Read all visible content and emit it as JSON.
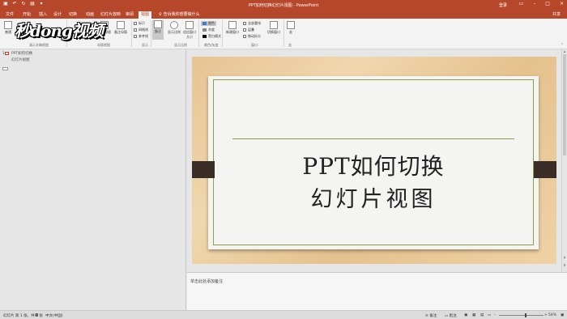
{
  "titlebar": {
    "title": "PPT如何切换幻灯片视图 - PowerPoint",
    "user": "登录",
    "qat_icons": [
      "save-icon",
      "undo-icon",
      "redo-icon",
      "start-icon",
      "customize-icon"
    ]
  },
  "tabs": [
    {
      "label": "文件"
    },
    {
      "label": "开始"
    },
    {
      "label": "插入"
    },
    {
      "label": "设计"
    },
    {
      "label": "切换"
    },
    {
      "label": "动画"
    },
    {
      "label": "幻灯片放映"
    },
    {
      "label": "审阅"
    },
    {
      "label": "视图",
      "active": true
    }
  ],
  "tellme": "告诉我你想要做什么",
  "share": "共享",
  "ribbon": {
    "view_buttons": {
      "normal": "普通",
      "notes_master": "备注母版"
    },
    "master_group": {
      "handout": "讲义母版",
      "notes": "备注母版"
    },
    "show": {
      "ruler": "标尺",
      "gridlines": "网格线",
      "guides": "参考线"
    },
    "zoom": {
      "notes": "备注",
      "zoom": "显示比例",
      "fit": "适应窗口大小"
    },
    "color": {
      "color": "颜色",
      "grayscale": "灰度",
      "bw": "黑白模式"
    },
    "window": {
      "new": "新建窗口",
      "arrange": "全部重排",
      "cascade": "层叠",
      "move_split": "移动拆分",
      "switch": "切换窗口"
    },
    "macro": "宏",
    "group_labels": {
      "presentation_views": "演示文稿视图",
      "master_views": "母版视图",
      "show": "显示",
      "zoom": "显示比例",
      "color": "颜色/灰度",
      "window": "窗口",
      "macros": "宏"
    }
  },
  "logo_text": "秒dong视频",
  "outline": {
    "slide_number": "1",
    "line1": "PPT如何切换",
    "line2": "幻灯片视图"
  },
  "slide": {
    "title_line1": "PPT如何切换",
    "title_line2": "幻灯片视图"
  },
  "notes_placeholder": "单击此处添加备注",
  "status": {
    "slide_info": "幻灯片 第 1 张，共 2 张",
    "language": "中文(中国)",
    "notes": "备注",
    "comments": "批注",
    "zoom_pct": "54%"
  }
}
